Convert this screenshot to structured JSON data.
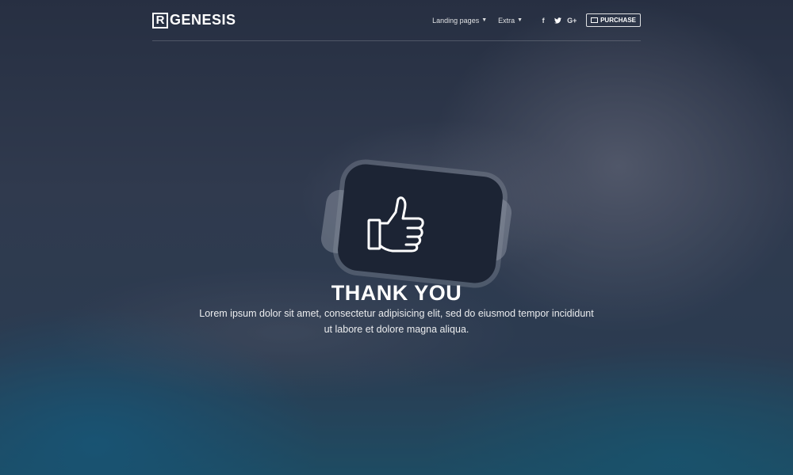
{
  "header": {
    "logo_letter": "R",
    "logo_text": "GENESIS",
    "nav": [
      {
        "label": "Landing pages"
      },
      {
        "label": "Extra"
      }
    ],
    "social": [
      {
        "icon": "facebook-icon",
        "glyph": "f"
      },
      {
        "icon": "twitter-icon",
        "glyph": "t"
      },
      {
        "icon": "google-plus-icon",
        "glyph": "G+"
      }
    ],
    "purchase_label": "PURCHASE"
  },
  "hero": {
    "icon": "thumbs-up-icon",
    "title": "THANK YOU",
    "description": "Lorem ipsum dolor sit amet, consectetur adipisicing elit, sed do eiusmod tempor incididunt ut labore et dolore magna aliqua."
  },
  "colors": {
    "text": "#ffffff",
    "accent_teal": "#1f6f8f"
  }
}
